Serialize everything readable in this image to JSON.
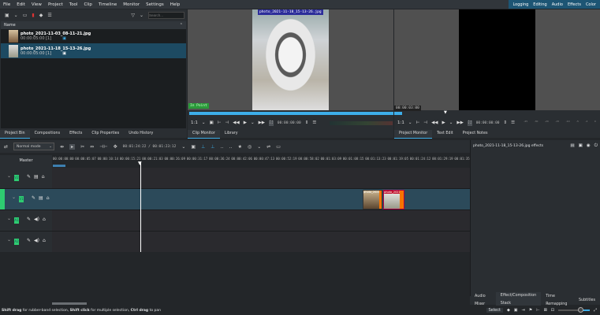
{
  "menu": [
    "File",
    "Edit",
    "View",
    "Project",
    "Tool",
    "Clip",
    "Timeline",
    "Monitor",
    "Settings",
    "Help"
  ],
  "workspaces": [
    "Logging",
    "Editing",
    "Audio",
    "Effects",
    "Color"
  ],
  "bin": {
    "search_placeholder": "Search...",
    "column": "Name",
    "items": [
      {
        "name": "photo_2021-11-03_08-11-21.jpg",
        "info": "00:00:05:00 [1]"
      },
      {
        "name": "photo_2021-11-18_15-13-26.jpg",
        "info": "00:00:05:00 [1]",
        "selected": true
      }
    ]
  },
  "left_tabs": [
    "Project Bin",
    "Compositions",
    "Effects",
    "Clip Properties",
    "Undo History"
  ],
  "clip_monitor": {
    "overlay": "photo_2021-11-18_15-13-26.jpg",
    "in_point": "In Point",
    "zoom": "1:1",
    "timecode": "00:00:00:00",
    "tabs": [
      "Clip Monitor",
      "Library"
    ]
  },
  "project_monitor": {
    "overlay_tc": "00:00:03:00",
    "zoom": "1:1",
    "timecode": "00:00:00:00",
    "tabs": [
      "Project Monitor",
      "Text Edit",
      "Project Notes"
    ],
    "meter": [
      "-45",
      "-30",
      "-20",
      "-15",
      "-10",
      "-5",
      "-2",
      "0"
    ]
  },
  "timeline": {
    "mode": "Normal mode",
    "position": "00:01:24:22 / 00:01:23:12",
    "master": "Master",
    "ruler": [
      "00:00:00:00",
      "00:00:05:07",
      "00:00:10:14",
      "00:00:15:21",
      "00:00:21:03",
      "00:00:26:09",
      "00:00:31:17",
      "00:00:36:24",
      "00:00:42:06",
      "00:00:47:13",
      "00:00:52:19",
      "00:00:58:02",
      "00:01:03:09",
      "00:01:08:15",
      "00:01:13:23",
      "00:01:19:05",
      "00:01:24:12",
      "00:01:29:19",
      "00:01:35:0"
    ],
    "tracks": [
      {
        "name": "V2",
        "type": "video"
      },
      {
        "name": "V1",
        "type": "video",
        "active": true
      },
      {
        "name": "A1",
        "type": "audio"
      },
      {
        "name": "A2",
        "type": "audio"
      }
    ],
    "clips": [
      {
        "label": "photo_2021-11-03_08-11-21"
      },
      {
        "label": "photo_2021"
      }
    ]
  },
  "effects": {
    "title": "photo_2021-11-18_15-13-26.jpg effects"
  },
  "right_tabs": [
    "Audio Mixer",
    "Effect/Composition Stack",
    "Time Remapping",
    "Subtitles"
  ],
  "status": {
    "select": "Select",
    "hint_parts": [
      [
        "Shift drag",
        true
      ],
      [
        " for rubber-band selection, ",
        false
      ],
      [
        "Shift click",
        true
      ],
      [
        " for multiple selection, ",
        false
      ],
      [
        "Ctrl drag",
        true
      ],
      [
        " to pan",
        false
      ]
    ]
  },
  "colors": {
    "accent": "#3daee9",
    "track_green": "#2ecc71",
    "clip_orange": "#f67400"
  }
}
